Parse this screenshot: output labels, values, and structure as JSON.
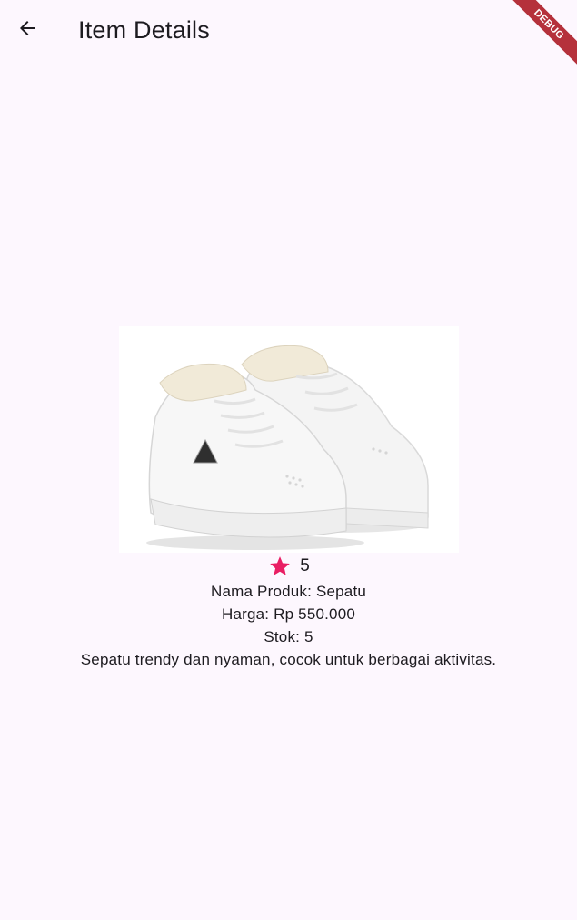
{
  "app_bar": {
    "title": "Item Details",
    "back_icon": "arrow-back-icon"
  },
  "debug_banner": {
    "label": "DEBUG",
    "color": "#b5313b"
  },
  "product": {
    "image_icon": "sneakers-image",
    "rating": "5",
    "rating_icon": "star-icon",
    "rating_color": "#e91e63",
    "name_line": "Nama Produk: Sepatu",
    "price_line": "Harga: Rp 550.000",
    "stock_line": "Stok: 5",
    "description": "Sepatu trendy dan nyaman, cocok untuk berbagai aktivitas."
  },
  "theme": {
    "background": "#fdf7fe",
    "text": "#1d1b20"
  }
}
